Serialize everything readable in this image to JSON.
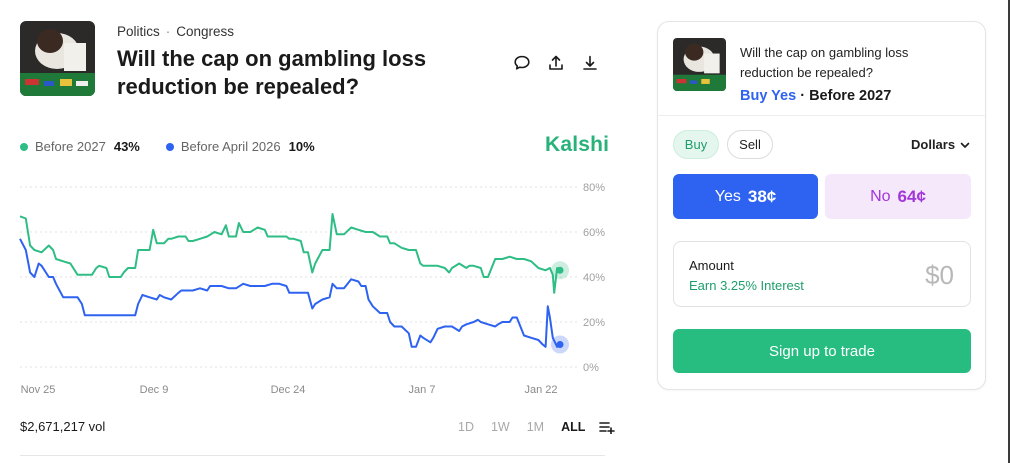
{
  "market": {
    "category": "Politics",
    "subcategory": "Congress",
    "title": "Will the cap on gambling loss reduction be repealed?"
  },
  "header_icons": [
    "comment-icon",
    "share-icon",
    "download-icon"
  ],
  "brand": "Kalshi",
  "legend": [
    {
      "name": "Before 2027",
      "value": "43%",
      "color": "#2ebd85"
    },
    {
      "name": "Before April 2026",
      "value": "10%",
      "color": "#2e62f0"
    }
  ],
  "volume": "$2,671,217 vol",
  "ranges": [
    "1D",
    "1W",
    "1M",
    "ALL"
  ],
  "active_range": "ALL",
  "chart_data": {
    "type": "line",
    "x_labels": [
      "Nov 25",
      "Dec 9",
      "Dec 24",
      "Jan 7",
      "Jan 22"
    ],
    "y_ticks": [
      "80%",
      "60%",
      "40%",
      "20%",
      "0%"
    ],
    "ylim": [
      0,
      80
    ],
    "grid": true,
    "series": [
      {
        "name": "Before 2027",
        "color": "#2ebd85",
        "points": [
          [
            0,
            67
          ],
          [
            0.8,
            66
          ],
          [
            1.4,
            54
          ],
          [
            2,
            52
          ],
          [
            3,
            51
          ],
          [
            4,
            54
          ],
          [
            4.6,
            52
          ],
          [
            5,
            48
          ],
          [
            6,
            47
          ],
          [
            7,
            46
          ],
          [
            8,
            41
          ],
          [
            9,
            41
          ],
          [
            10,
            41
          ],
          [
            10.6,
            44
          ],
          [
            11,
            45
          ],
          [
            12,
            44
          ],
          [
            12.4,
            40
          ],
          [
            13,
            40
          ],
          [
            14,
            40
          ],
          [
            14.4,
            42
          ],
          [
            15,
            44
          ],
          [
            16,
            44
          ],
          [
            16.4,
            52
          ],
          [
            17,
            52
          ],
          [
            18,
            52
          ],
          [
            18.5,
            61
          ],
          [
            19,
            55
          ],
          [
            20,
            55
          ],
          [
            20.6,
            57
          ],
          [
            21,
            57
          ],
          [
            22,
            58
          ],
          [
            23,
            58
          ],
          [
            23.4,
            56
          ],
          [
            24,
            56
          ],
          [
            25,
            57
          ],
          [
            26,
            58
          ],
          [
            26.5,
            59
          ],
          [
            27,
            60
          ],
          [
            28,
            59
          ],
          [
            28.6,
            63
          ],
          [
            29,
            58
          ],
          [
            30,
            58
          ],
          [
            30.4,
            64
          ],
          [
            31,
            60
          ],
          [
            32,
            60
          ],
          [
            33,
            62
          ],
          [
            34,
            61
          ],
          [
            34.4,
            58
          ],
          [
            35,
            58
          ],
          [
            36,
            58
          ],
          [
            37,
            58
          ],
          [
            37.4,
            57
          ],
          [
            38,
            57
          ],
          [
            39,
            56
          ],
          [
            39.4,
            51
          ],
          [
            40,
            51
          ],
          [
            40.6,
            42
          ],
          [
            41,
            46
          ],
          [
            42,
            52
          ],
          [
            43,
            52
          ],
          [
            43.4,
            68
          ],
          [
            44,
            59
          ],
          [
            45,
            59
          ],
          [
            46,
            62
          ],
          [
            47,
            61
          ],
          [
            48,
            60
          ],
          [
            49,
            60
          ],
          [
            50,
            58
          ],
          [
            51,
            58
          ],
          [
            51.4,
            55
          ],
          [
            52,
            55
          ],
          [
            53,
            53
          ],
          [
            54,
            52
          ],
          [
            55,
            52
          ],
          [
            55.6,
            46
          ],
          [
            56,
            45
          ],
          [
            57,
            45
          ],
          [
            58,
            45
          ],
          [
            59,
            44
          ],
          [
            59.6,
            42
          ],
          [
            60,
            44
          ],
          [
            61,
            46
          ],
          [
            62,
            44
          ],
          [
            62.4,
            45
          ],
          [
            63,
            45
          ],
          [
            64,
            44
          ],
          [
            64.4,
            40
          ],
          [
            65,
            40
          ],
          [
            66,
            48
          ],
          [
            67,
            48
          ],
          [
            68,
            49
          ],
          [
            69,
            48
          ],
          [
            70,
            48
          ],
          [
            71,
            47
          ],
          [
            72,
            44
          ],
          [
            73,
            43
          ],
          [
            73.6,
            44
          ],
          [
            74,
            41
          ],
          [
            74.2,
            33
          ],
          [
            74.6,
            44
          ],
          [
            75,
            43
          ]
        ]
      },
      {
        "name": "Before April 2026",
        "color": "#2e62f0",
        "points": [
          [
            0,
            57
          ],
          [
            0.8,
            52
          ],
          [
            1.4,
            42
          ],
          [
            2,
            40
          ],
          [
            2.6,
            46
          ],
          [
            3,
            45
          ],
          [
            4,
            40
          ],
          [
            4.6,
            40
          ],
          [
            5,
            37
          ],
          [
            6,
            31
          ],
          [
            7,
            31
          ],
          [
            8,
            31
          ],
          [
            8.6,
            28
          ],
          [
            9,
            23
          ],
          [
            10,
            23
          ],
          [
            11,
            23
          ],
          [
            12,
            23
          ],
          [
            13,
            23
          ],
          [
            14,
            23
          ],
          [
            15,
            23
          ],
          [
            16,
            23
          ],
          [
            16.4,
            28
          ],
          [
            17,
            32
          ],
          [
            18,
            31
          ],
          [
            19,
            30
          ],
          [
            19.4,
            32
          ],
          [
            20,
            31
          ],
          [
            21,
            30
          ],
          [
            22,
            33
          ],
          [
            22.4,
            34
          ],
          [
            23,
            34
          ],
          [
            24,
            34
          ],
          [
            25,
            35
          ],
          [
            26,
            34
          ],
          [
            26.4,
            36
          ],
          [
            27,
            36
          ],
          [
            28,
            36
          ],
          [
            29,
            35
          ],
          [
            30,
            35
          ],
          [
            31,
            37
          ],
          [
            32,
            36
          ],
          [
            33,
            36
          ],
          [
            34,
            36
          ],
          [
            35,
            37
          ],
          [
            36,
            37
          ],
          [
            37,
            36
          ],
          [
            37.4,
            33
          ],
          [
            38,
            33
          ],
          [
            39,
            33
          ],
          [
            40,
            33
          ],
          [
            40.6,
            26
          ],
          [
            41,
            28
          ],
          [
            42,
            30
          ],
          [
            43,
            31
          ],
          [
            43.4,
            37
          ],
          [
            44,
            35
          ],
          [
            45,
            35
          ],
          [
            46,
            39
          ],
          [
            47,
            38
          ],
          [
            47.4,
            36
          ],
          [
            48,
            36
          ],
          [
            48.4,
            30
          ],
          [
            49,
            27
          ],
          [
            50,
            24
          ],
          [
            51,
            24
          ],
          [
            51.4,
            20
          ],
          [
            52,
            18
          ],
          [
            53,
            18
          ],
          [
            54,
            15
          ],
          [
            54.4,
            9
          ],
          [
            55,
            9
          ],
          [
            55.6,
            14
          ],
          [
            56,
            13
          ],
          [
            57,
            11
          ],
          [
            57.4,
            13
          ],
          [
            58,
            17
          ],
          [
            59,
            18
          ],
          [
            60,
            18
          ],
          [
            61,
            16
          ],
          [
            61.4,
            18
          ],
          [
            62,
            19
          ],
          [
            63,
            20
          ],
          [
            63.6,
            21
          ],
          [
            64,
            20
          ],
          [
            65,
            19
          ],
          [
            66,
            18
          ],
          [
            66.4,
            19
          ],
          [
            67,
            20
          ],
          [
            68,
            20
          ],
          [
            68.4,
            22
          ],
          [
            69,
            22
          ],
          [
            70,
            14
          ],
          [
            71,
            13
          ],
          [
            72,
            12
          ],
          [
            72.6,
            10
          ],
          [
            73,
            9
          ],
          [
            73.3,
            27
          ],
          [
            73.6,
            22
          ],
          [
            74,
            13
          ],
          [
            74.6,
            9
          ],
          [
            75,
            10
          ]
        ]
      }
    ],
    "x_range": [
      0,
      75
    ]
  },
  "trade_card": {
    "question": "Will the cap on gambling loss reduction be repealed?",
    "outcome": "Buy Yes",
    "separator": "·",
    "timeframe": "Before 2027",
    "buy_label": "Buy",
    "sell_label": "Sell",
    "currency": "Dollars",
    "yes_label": "Yes",
    "yes_price": "38¢",
    "no_label": "No",
    "no_price": "64¢",
    "amount_label": "Amount",
    "interest_text": "Earn 3.25% Interest",
    "amount_value": "$0",
    "signup_label": "Sign up to trade"
  }
}
